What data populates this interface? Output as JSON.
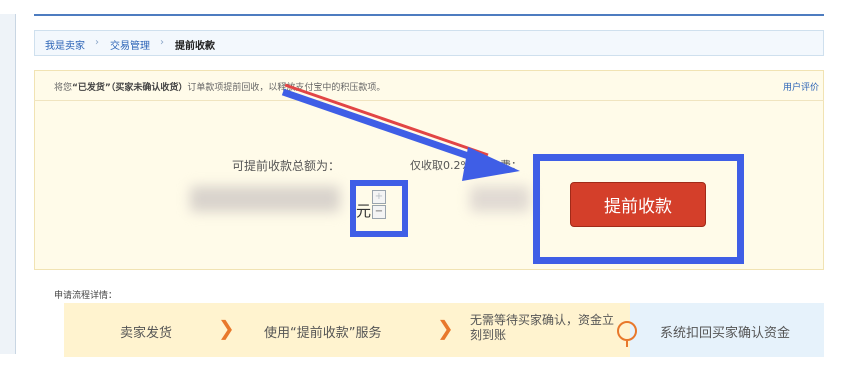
{
  "breadcrumb": {
    "items": [
      "我是卖家",
      "交易管理",
      "提前收款"
    ],
    "separator": "›"
  },
  "notice": {
    "prefix": "将您",
    "bold": "“已发货”（买家未确认收货）",
    "suffix": "订单款项提前回收，以释放支付宝中的积压款项。"
  },
  "header_link": "用户评价",
  "amount": {
    "label": "可提前收款总额为：",
    "fee_note": "仅收取0.2%",
    "fee_tail": "费：",
    "currency": "元",
    "stepper_up": "+",
    "stepper_down": "−"
  },
  "cta_button": "提前收款",
  "process": {
    "title": "申请流程详情：",
    "steps": [
      "卖家发货",
      "使用“提前收款”服务",
      "无需等待买家确认，资金立刻到账",
      "系统扣回买家确认资金"
    ]
  },
  "colors": {
    "highlight": "#3f5ee6",
    "cta": "#d43f2a",
    "chevron": "#e8782b",
    "panel_bg": "#fffbe9"
  }
}
